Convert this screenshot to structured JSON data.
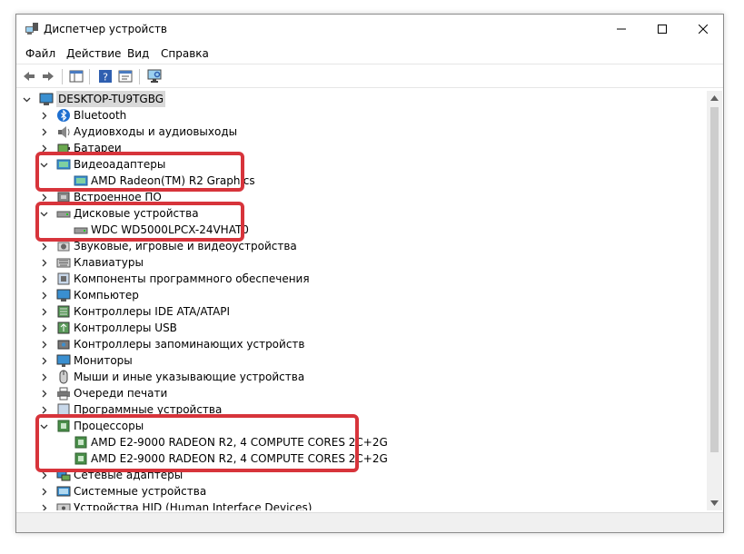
{
  "window": {
    "title": "Диспетчер устройств"
  },
  "menu": [
    "Файл",
    "Действие",
    "Вид",
    "Справка"
  ],
  "tree": {
    "root": "DESKTOP-TU9TGBG",
    "categories": [
      {
        "label": "Bluetooth",
        "icon": "bluetooth-icon",
        "expanded": false
      },
      {
        "label": "Аудиовходы и аудиовыходы",
        "icon": "speaker-icon",
        "expanded": false
      },
      {
        "label": "Батареи",
        "icon": "battery-icon",
        "expanded": false
      },
      {
        "label": "Видеоадаптеры",
        "icon": "display-adapter-icon",
        "expanded": true,
        "children": [
          "AMD Radeon(TM) R2 Graphics"
        ]
      },
      {
        "label": "Встроенное ПО",
        "icon": "firmware-icon",
        "expanded": false
      },
      {
        "label": "Дисковые устройства",
        "icon": "disk-drive-icon",
        "expanded": true,
        "children": [
          "WDC WD5000LPCX-24VHAT0"
        ]
      },
      {
        "label": "Звуковые, игровые и видеоустройства",
        "icon": "sound-icon",
        "expanded": false
      },
      {
        "label": "Клавиатуры",
        "icon": "keyboard-icon",
        "expanded": false
      },
      {
        "label": "Компоненты программного обеспечения",
        "icon": "software-component-icon",
        "expanded": false
      },
      {
        "label": "Компьютер",
        "icon": "computer-icon",
        "expanded": false
      },
      {
        "label": "Контроллеры IDE ATA/ATAPI",
        "icon": "ide-controller-icon",
        "expanded": false
      },
      {
        "label": "Контроллеры USB",
        "icon": "usb-icon",
        "expanded": false
      },
      {
        "label": "Контроллеры запоминающих устройств",
        "icon": "storage-controller-icon",
        "expanded": false
      },
      {
        "label": "Мониторы",
        "icon": "monitor-icon",
        "expanded": false
      },
      {
        "label": "Мыши и иные указывающие устройства",
        "icon": "mouse-icon",
        "expanded": false
      },
      {
        "label": "Очереди печати",
        "icon": "printer-icon",
        "expanded": false
      },
      {
        "label": "Программные устройства",
        "icon": "software-device-icon",
        "expanded": false
      },
      {
        "label": "Процессоры",
        "icon": "processor-icon",
        "expanded": true,
        "children": [
          "AMD E2-9000 RADEON R2, 4 COMPUTE CORES 2C+2G",
          "AMD E2-9000 RADEON R2, 4 COMPUTE CORES 2C+2G"
        ]
      },
      {
        "label": "Сетевые адаптеры",
        "icon": "network-icon",
        "expanded": false
      },
      {
        "label": "Системные устройства",
        "icon": "system-device-icon",
        "expanded": false
      },
      {
        "label": "Устройства HID (Human Interface Devices)",
        "icon": "hid-icon",
        "expanded": false
      }
    ]
  },
  "colors": {
    "highlight": "#d7343b",
    "selection": "#d9d9d9"
  }
}
